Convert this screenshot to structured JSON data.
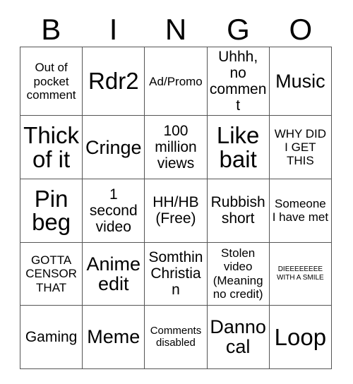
{
  "card": {
    "title": "BINGO",
    "header_letters": [
      "B",
      "I",
      "N",
      "G",
      "O"
    ],
    "colors": {
      "background": "#ffffff",
      "text": "#000000",
      "grid_line": "#555555"
    },
    "rows": [
      [
        {
          "text": "Out of pocket comment",
          "size": "sm"
        },
        {
          "text": "Rdr2",
          "size": "xl"
        },
        {
          "text": "Ad/Promo",
          "size": "sm"
        },
        {
          "text": "Uhhh, no comment",
          "size": "md"
        },
        {
          "text": "Music",
          "size": "lg"
        }
      ],
      [
        {
          "text": "Thick of it",
          "size": "xl"
        },
        {
          "text": "Cringe",
          "size": "lg"
        },
        {
          "text": "100 million views",
          "size": "md"
        },
        {
          "text": "Like bait",
          "size": "xl"
        },
        {
          "text": "WHY DID I GET THIS",
          "size": "sm"
        }
      ],
      [
        {
          "text": "Pin beg",
          "size": "xl"
        },
        {
          "text": "1 second video",
          "size": "md"
        },
        {
          "text": "HH/HB (Free)",
          "size": "md"
        },
        {
          "text": "Rubbish short",
          "size": "md"
        },
        {
          "text": "Someone I have met",
          "size": "sm"
        }
      ],
      [
        {
          "text": "GOTTA CENSOR THAT",
          "size": "sm"
        },
        {
          "text": "Anime edit",
          "size": "lg"
        },
        {
          "text": "Somthin Christian",
          "size": "md"
        },
        {
          "text": "Stolen video (Meaning no credit)",
          "size": "sm"
        },
        {
          "text": "DIEEEEEEEE WITH A SMILE",
          "size": "tiny"
        }
      ],
      [
        {
          "text": "Gaming",
          "size": "md"
        },
        {
          "text": "Meme",
          "size": "lg"
        },
        {
          "text": "Comments disabled",
          "size": "xs"
        },
        {
          "text": "Danno cal",
          "size": "lg"
        },
        {
          "text": "Loop",
          "size": "xl"
        }
      ]
    ]
  }
}
